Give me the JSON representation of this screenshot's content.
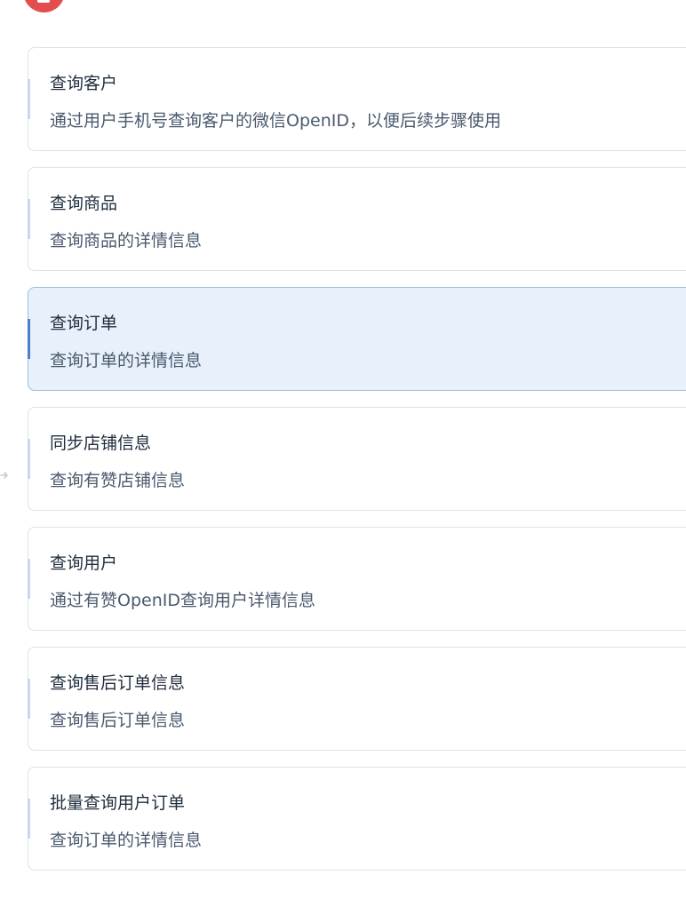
{
  "cards": [
    {
      "title": "查询客户",
      "description": "通过用户手机号查询客户的微信OpenID，以便后续步骤使用",
      "selected": false
    },
    {
      "title": "查询商品",
      "description": "查询商品的详情信息",
      "selected": false
    },
    {
      "title": "查询订单",
      "description": "查询订单的详情信息",
      "selected": true
    },
    {
      "title": "同步店铺信息",
      "description": "查询有赞店铺信息",
      "selected": false
    },
    {
      "title": "查询用户",
      "description": "通过有赞OpenID查询用户详情信息",
      "selected": false
    },
    {
      "title": "查询售后订单信息",
      "description": "查询售后订单信息",
      "selected": false
    },
    {
      "title": "批量查询用户订单",
      "description": "查询订单的详情信息",
      "selected": false
    }
  ],
  "colors": {
    "accent": "#4a7fcb",
    "selected_bg": "#e8f0fb",
    "logo": "#e34d4d"
  },
  "icons": {
    "logo": "brand-logo-icon",
    "connector": "arrow-right-icon"
  }
}
